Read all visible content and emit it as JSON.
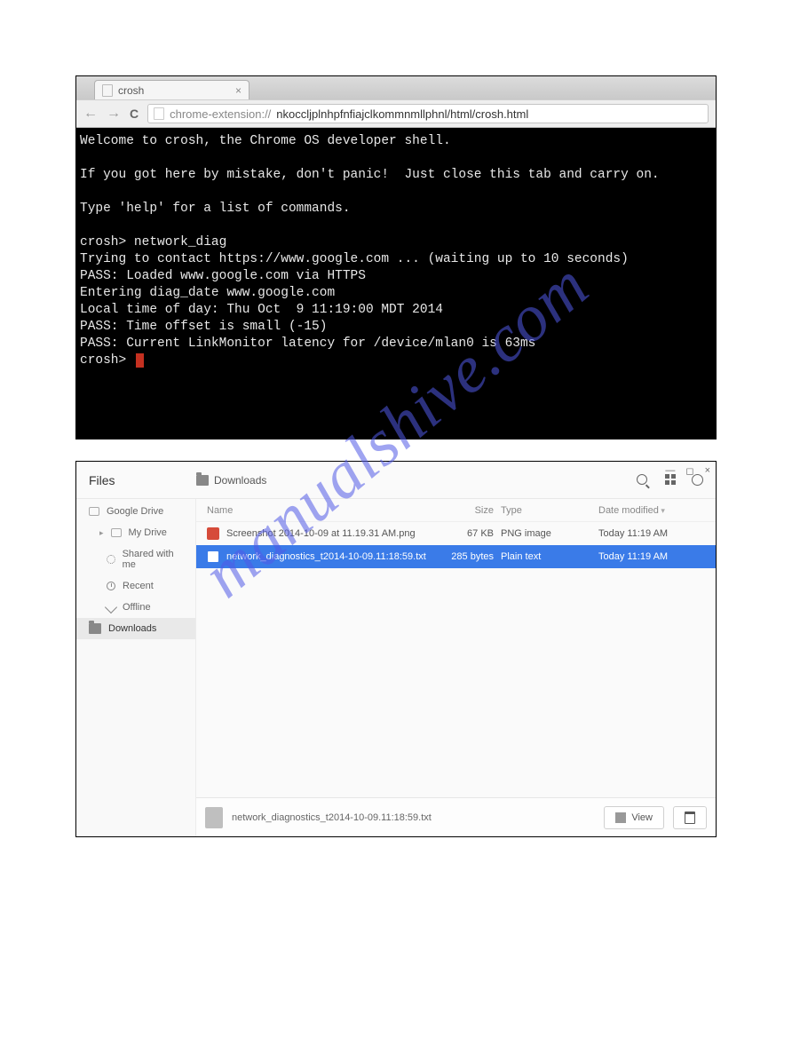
{
  "watermark": "manualshive.com",
  "browser": {
    "tab_title": "crosh",
    "url_prefix": "chrome-extension://",
    "url_rest": "nkoccljplnhpfnfiajclkommnmllphnl/html/crosh.html"
  },
  "terminal": {
    "lines": [
      "Welcome to crosh, the Chrome OS developer shell.",
      "",
      "If you got here by mistake, don't panic!  Just close this tab and carry on.",
      "",
      "Type 'help' for a list of commands.",
      "",
      "crosh> network_diag",
      "Trying to contact https://www.google.com ... (waiting up to 10 seconds)",
      "PASS: Loaded www.google.com via HTTPS",
      "Entering diag_date www.google.com",
      "Local time of day: Thu Oct  9 11:19:00 MDT 2014",
      "PASS: Time offset is small (-15)",
      "PASS: Current LinkMonitor latency for /device/mlan0 is 63ms"
    ],
    "prompt": "crosh> "
  },
  "files": {
    "app_title": "Files",
    "breadcrumb": "Downloads",
    "sidebar": {
      "drive": "Google Drive",
      "mydrive": "My Drive",
      "shared": "Shared with me",
      "recent": "Recent",
      "offline": "Offline",
      "downloads": "Downloads"
    },
    "columns": {
      "name": "Name",
      "size": "Size",
      "type": "Type",
      "date": "Date modified"
    },
    "rows": [
      {
        "name": "Screenshot 2014-10-09 at 11.19.31 AM.png",
        "size": "67 KB",
        "type": "PNG image",
        "date": "Today 11:19 AM",
        "kind": "png",
        "selected": false
      },
      {
        "name": "network_diagnostics_t2014-10-09.11:18:59.txt",
        "size": "285 bytes",
        "type": "Plain text",
        "date": "Today 11:19 AM",
        "kind": "txt",
        "selected": true
      }
    ],
    "status_file": "network_diagnostics_t2014-10-09.11:18:59.txt",
    "view_button": "View"
  }
}
